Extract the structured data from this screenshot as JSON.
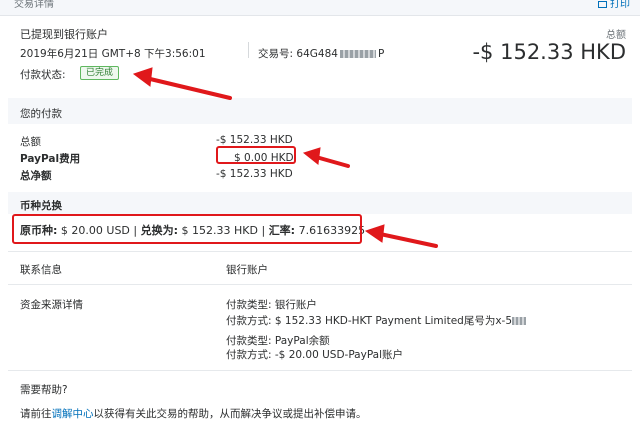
{
  "header": {
    "breadcrumb": "交易详情",
    "title": "已提现到银行账户",
    "date": "2019年6月21日 GMT+8 下午3:56:01",
    "txn_label": "交易号:",
    "txn_value_prefix": "64G484",
    "txn_value_suffix": "P",
    "total_label": "总额",
    "total_amount": "-$ 152.33 HKD",
    "status_label": "付款状态:",
    "status_value": "已完成"
  },
  "payment": {
    "section_title": "您的付款",
    "rows": [
      {
        "label": "总额",
        "value": "-$ 152.33 HKD"
      },
      {
        "label": "PayPal费用",
        "value": "$ 0.00 HKD"
      },
      {
        "label": "总净额",
        "value": "-$ 152.33 HKD"
      }
    ]
  },
  "fx": {
    "section_title": "币种兑换",
    "original_label": "原币种:",
    "original_value": "$ 20.00 USD",
    "converted_label": "兑换为:",
    "converted_value": "$ 152.33 HKD",
    "rate_label": "汇率:",
    "rate_value": "7.61633925",
    "sep": "|"
  },
  "contact": {
    "label": "联系信息",
    "value": "银行账户"
  },
  "funding": {
    "label": "资金来源详情",
    "lines": [
      {
        "k": "付款类型:",
        "v": "银行账户"
      },
      {
        "k": "付款方式:",
        "v": "$ 152.33 HKD-HKT Payment Limited尾号为x-5"
      },
      {
        "k": "付款类型:",
        "v": "PayPal余额"
      },
      {
        "k": "付款方式:",
        "v": "-$ 20.00 USD-PayPal账户"
      }
    ]
  },
  "help": {
    "title": "需要帮助?",
    "text_before": "请前往",
    "link": "调解中心",
    "text_after": "以获得有关此交易的帮助，从而解决争议或提出补偿申请。"
  },
  "topbar": {
    "print_label": "打印"
  },
  "colors": {
    "accent": "#0070ba",
    "annotation": "#e0181b",
    "status": "#2e7d32"
  }
}
